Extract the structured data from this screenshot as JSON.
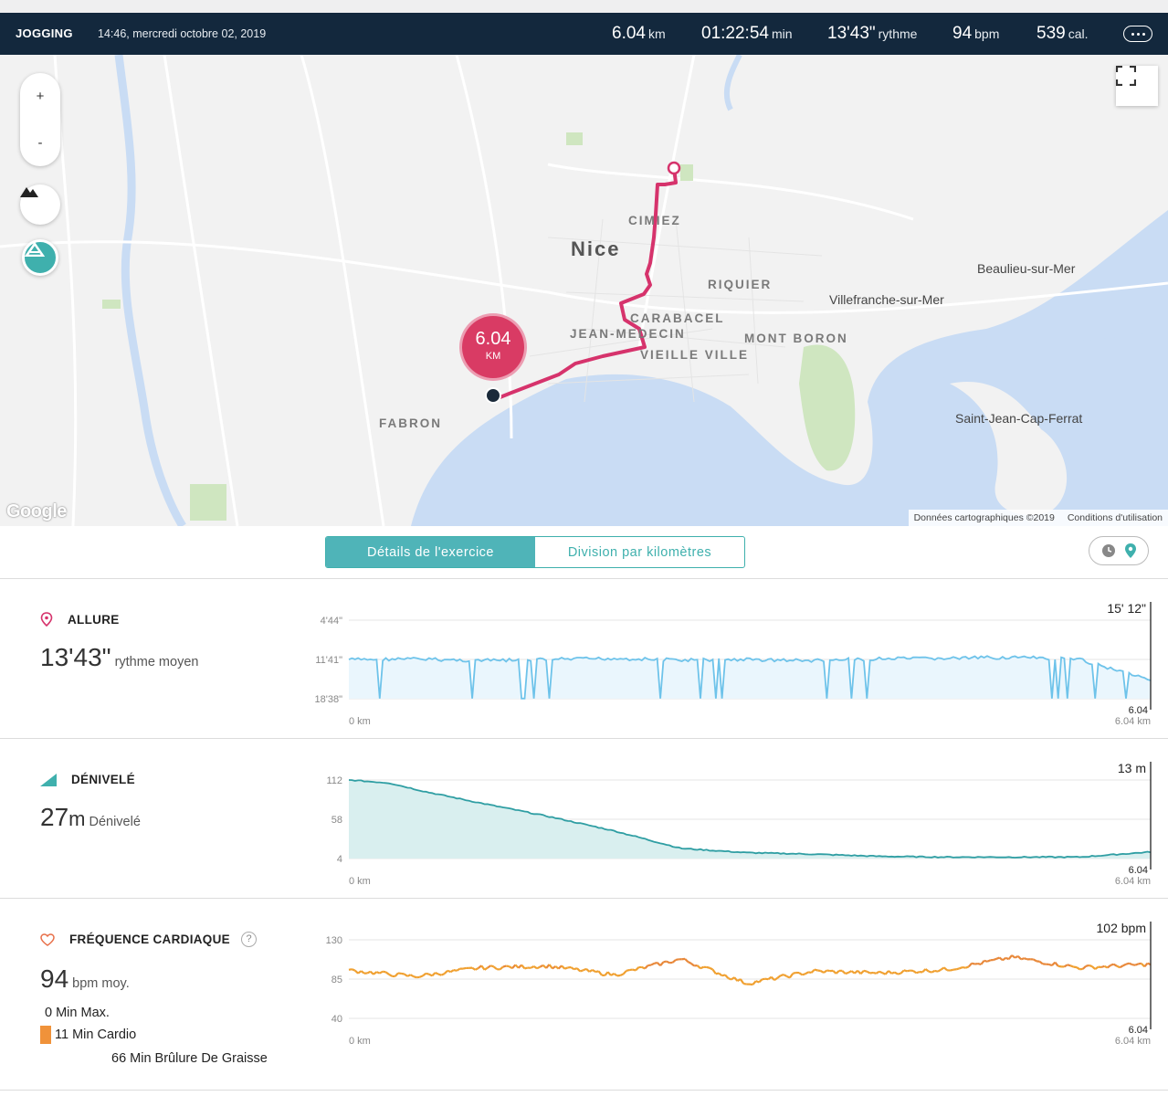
{
  "header": {
    "activity": "JOGGING",
    "datetime": "14:46, mercredi octobre 02, 2019",
    "stats": [
      {
        "value": "6.04",
        "unit": "km"
      },
      {
        "value": "01:22:54",
        "unit": "min"
      },
      {
        "value": "13'43\"",
        "unit": "rythme"
      },
      {
        "value": "94",
        "unit": "bpm"
      },
      {
        "value": "539",
        "unit": "cal."
      }
    ]
  },
  "map": {
    "zoom_in": "+",
    "zoom_out": "-",
    "distance_marker": {
      "value": "6.04",
      "unit": "KM"
    },
    "labels": {
      "nice": "Nice",
      "cimiez": "CIMIEZ",
      "riquier": "RIQUIER",
      "carabacel": "CARABACEL",
      "jean_medecin": "JEAN-MEDECIN",
      "vieille_ville": "VIEILLE VILLE",
      "mont_boron": "MONT BORON",
      "fabron": "FABRON",
      "beaulieu": "Beaulieu-sur-Mer",
      "villefranche": "Villefranche-sur-Mer",
      "saint_jean": "Saint-Jean-Cap-Ferrat",
      "google": "Google"
    },
    "attribution": "Données cartographiques ©2019",
    "terms": "Conditions d'utilisation"
  },
  "tabs": {
    "details": "Détails de l'exercice",
    "splits": "Division par kilomètres"
  },
  "panels": {
    "pace": {
      "title": "ALLURE",
      "big": "13'43\"",
      "sub": "rythme moyen",
      "current": "15' 12\"",
      "y_ticks": [
        "4'44\"",
        "11'41\"",
        "18'38\""
      ],
      "x_start": "0 km",
      "x_end_value": "6.04",
      "x_end": "6.04 km"
    },
    "elevation": {
      "title": "DÉNIVELÉ",
      "big": "27",
      "big_unit": "m",
      "sub": "Dénivelé",
      "current": "13 m",
      "y_ticks": [
        "112",
        "58",
        "4"
      ],
      "x_start": "0 km",
      "x_end_value": "6.04",
      "x_end": "6.04 km"
    },
    "heart": {
      "title": "FRÉQUENCE CARDIAQUE",
      "help": "?",
      "big": "94",
      "sub": "bpm moy.",
      "zones": [
        "0 Min Max.",
        "11 Min Cardio",
        "66 Min Brûlure De Graisse"
      ],
      "current": "102 bpm",
      "y_ticks": [
        "130",
        "85",
        "40"
      ],
      "x_start": "0 km",
      "x_end_value": "6.04",
      "x_end": "6.04 km"
    }
  },
  "colors": {
    "header_bg": "#13283d",
    "accent": "#3fb0ad",
    "route": "#d6336c",
    "pace_line": "#6ec3ea",
    "elevation_line": "#2f9ea3",
    "hr_orange": "#f0a030",
    "hr_teal": "#4fb6b8"
  },
  "chart_data": [
    {
      "type": "area",
      "title": "ALLURE",
      "x": [
        0,
        0.5,
        1,
        1.5,
        2,
        2.5,
        3,
        3.5,
        4,
        4.5,
        5,
        5.5,
        6.04
      ],
      "values_min_per_km": [
        11.7,
        11.6,
        11.9,
        11.7,
        11.5,
        11.8,
        11.7,
        11.9,
        11.6,
        11.5,
        11.3,
        11.7,
        15.2
      ],
      "ylim_labels": [
        "4'44\"",
        "18'38\""
      ],
      "xlabel": "km"
    },
    {
      "type": "area",
      "title": "DÉNIVELÉ",
      "x": [
        0,
        0.3,
        0.6,
        1.0,
        1.5,
        2.0,
        2.5,
        3.0,
        3.5,
        4.0,
        4.5,
        5.0,
        5.5,
        6.04
      ],
      "values": [
        112,
        108,
        95,
        80,
        62,
        42,
        18,
        12,
        10,
        7,
        6,
        6,
        6,
        13
      ],
      "ylim": [
        4,
        112
      ],
      "xlabel": "km"
    },
    {
      "type": "line",
      "title": "FRÉQUENCE CARDIAQUE",
      "x": [
        0,
        0.5,
        1,
        1.5,
        2,
        2.5,
        3,
        3.5,
        4,
        4.5,
        5,
        5.5,
        6.04
      ],
      "values": [
        95,
        88,
        98,
        100,
        90,
        108,
        80,
        94,
        92,
        96,
        110,
        98,
        102
      ],
      "ylim": [
        40,
        130
      ],
      "xlabel": "km"
    }
  ]
}
